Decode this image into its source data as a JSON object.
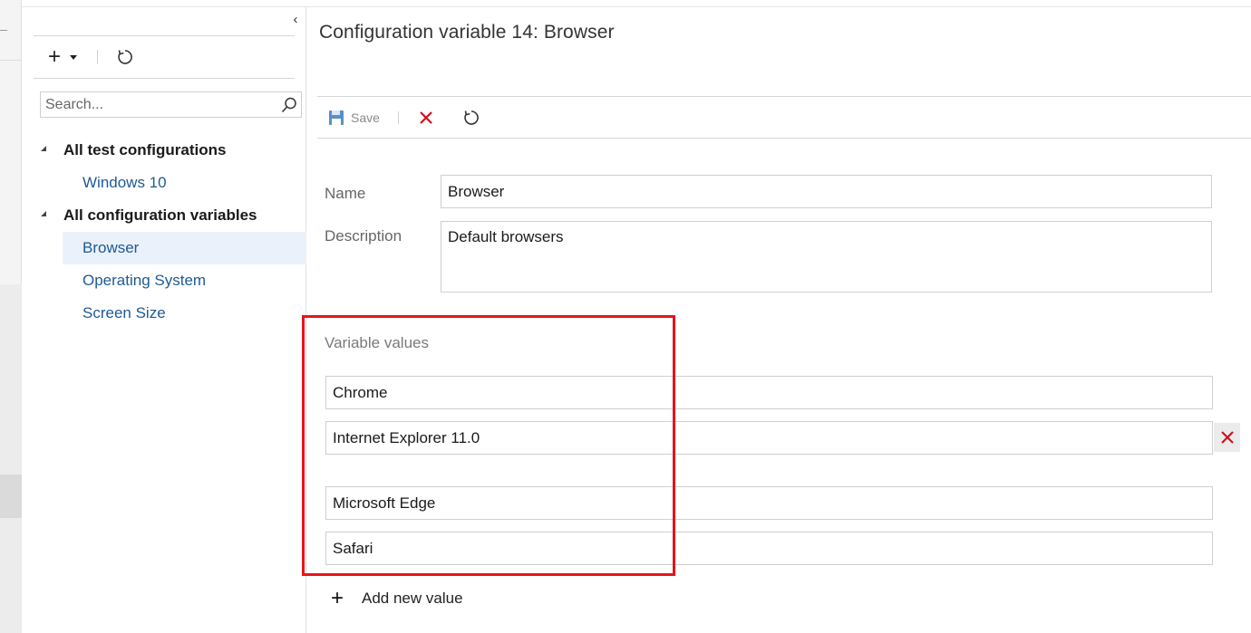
{
  "tree_pane": {
    "collapse_glyph": "‹",
    "toolbar": {
      "new_icon": "plus-icon",
      "new_menu_icon": "caret-down-icon",
      "refresh_icon": "refresh-icon"
    },
    "search": {
      "placeholder": "Search...",
      "value": "",
      "icon": "search-icon"
    },
    "groups": [
      {
        "label": "All test configurations",
        "children": [
          "Windows 10"
        ]
      },
      {
        "label": "All configuration variables",
        "children": [
          "Browser",
          "Operating System",
          "Screen Size"
        ]
      }
    ],
    "selected": "Browser"
  },
  "detail": {
    "title": "Configuration variable 14: Browser",
    "toolbar": {
      "save_label": "Save",
      "save_icon": "save-icon",
      "discard_icon": "close-icon",
      "refresh_icon": "refresh-icon"
    },
    "name_label": "Name",
    "name_value": "Browser",
    "description_label": "Description",
    "description_value": "Default browsers",
    "variable_values_label": "Variable values",
    "values": [
      "Chrome",
      "Internet Explorer 11.0",
      "Microsoft Edge",
      "Safari"
    ],
    "add_value_label": "Add new value"
  },
  "colors": {
    "accent_link": "#1f5a94",
    "highlight": "#e8141b",
    "delete_red": "#d0121b",
    "save_icon": "#5b8fc7"
  }
}
